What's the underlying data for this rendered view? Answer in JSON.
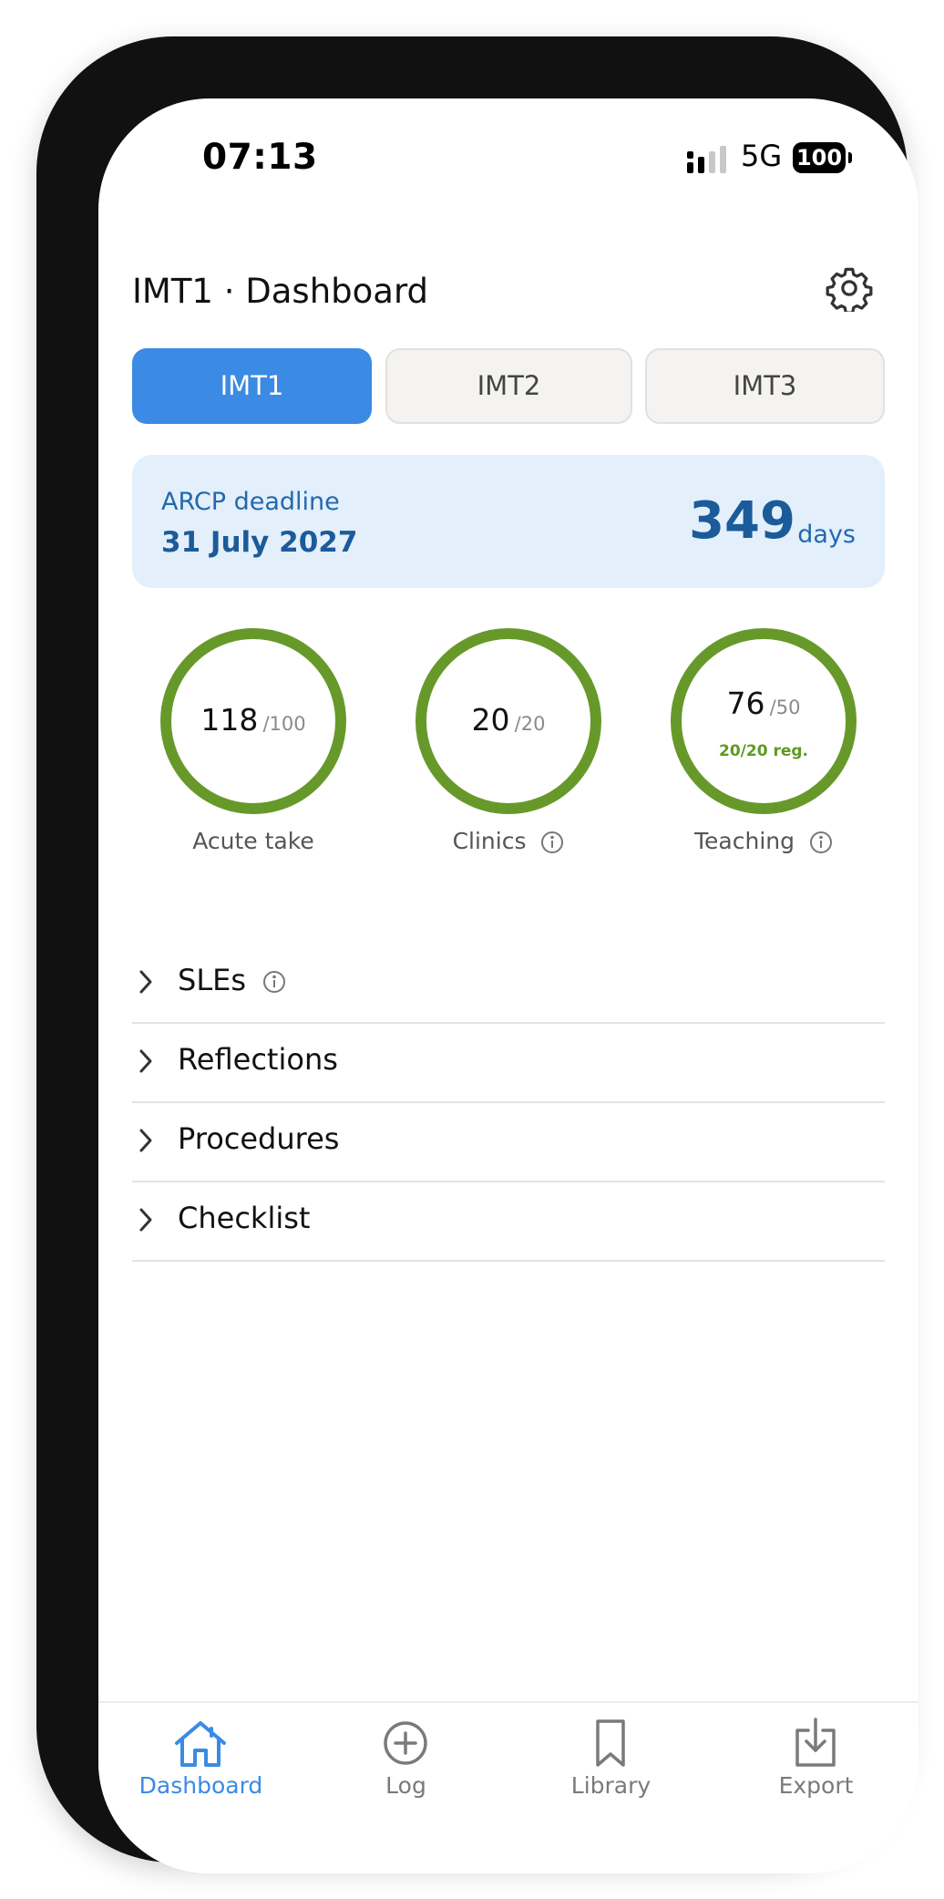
{
  "status_bar": {
    "time": "07:13",
    "network": "5G",
    "battery": "100"
  },
  "header": {
    "title": "IMT1 · Dashboard"
  },
  "segments": [
    {
      "label": "IMT1",
      "selected": true
    },
    {
      "label": "IMT2",
      "selected": false
    },
    {
      "label": "IMT3",
      "selected": false
    }
  ],
  "deadline": {
    "label": "ARCP deadline",
    "date": "31 July 2027",
    "days": "349",
    "days_unit": "days"
  },
  "rings": [
    {
      "value": "118",
      "target": "/100",
      "label": "Acute take",
      "sub": ""
    },
    {
      "value": "20",
      "target": "/20",
      "label": "Clinics",
      "sub": ""
    },
    {
      "value": "76",
      "target": "/50",
      "label": "Teaching",
      "sub": "20/20 reg."
    }
  ],
  "sections": [
    {
      "label": "SLEs"
    },
    {
      "label": "Reflections"
    },
    {
      "label": "Procedures"
    },
    {
      "label": "Checklist"
    }
  ],
  "tabbar": [
    {
      "label": "Dashboard",
      "icon": "house-icon",
      "active": true
    },
    {
      "label": "Log",
      "icon": "plus-circle-icon",
      "active": false
    },
    {
      "label": "Library",
      "icon": "bookmark-icon",
      "active": false
    },
    {
      "label": "Export",
      "icon": "download-icon",
      "active": false
    }
  ],
  "colors": {
    "accent": "#3b8ae3",
    "ring": "#66992a",
    "deadline_bg": "#e3effb"
  }
}
